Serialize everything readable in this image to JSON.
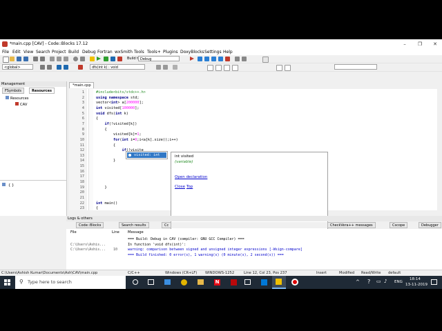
{
  "window": {
    "title": "*main.cpp [CAV] - Code::Blocks 17.12"
  },
  "menu": [
    "File",
    "Edit",
    "View",
    "Search",
    "Project",
    "Build",
    "Debug",
    "Fortran",
    "wxSmith",
    "Tools",
    "Tools+",
    "Plugins",
    "DoxyBlocks",
    "Settings",
    "Help"
  ],
  "toolbar": {
    "build_target": "Debug",
    "scope": "<global>",
    "function": "dfs(int k) : void"
  },
  "management": {
    "title": "Management",
    "tabs": [
      "FSymbols",
      "Resources"
    ],
    "active_tab": "Resources",
    "tree": [
      "Resources",
      "CAV"
    ],
    "bottom_item": "{ }"
  },
  "editor": {
    "tab": "*main.cpp",
    "line_numbers": [
      "1",
      "2",
      "3",
      "4",
      "5",
      "6",
      "7",
      "8",
      "9",
      "10",
      "11",
      "12",
      "13",
      "14",
      "15",
      "16",
      "17",
      "18",
      "19",
      "20",
      "21",
      "22",
      "23"
    ],
    "lines": [
      "#include<bits/stdc++.h>",
      "using namespace std;",
      "vector<int> a[200000];",
      "int visited[100000];",
      "void dfs(int k)",
      "{",
      "    if(!visited[k])",
      "    {",
      "        visited[k]=1;",
      "        for(int i=0;i<a[k].size();i++)",
      "        {",
      "            if(!visite",
      "",
      "        }",
      "",
      "",
      "",
      "",
      "    }",
      "",
      "",
      "int main()",
      "{"
    ],
    "autocomplete": {
      "item": "visited: int"
    },
    "tooltip": {
      "signature": "int visited",
      "kind": "(variable)",
      "open_declaration": "Open declaration",
      "close": "Close",
      "top": "Top"
    }
  },
  "logs": {
    "title": "Logs & others",
    "tabs": [
      "Code::Blocks",
      "Search results",
      "Cc",
      "CheckVera++ messages",
      "Cscope",
      "Debugger"
    ],
    "headers": [
      "File",
      "Line",
      "Message"
    ],
    "rows": [
      {
        "file": "",
        "line": "",
        "message": "=== Build: Debug in CAV (compiler: GNU GCC Compiler) ===",
        "color": "#000000"
      },
      {
        "file": "C:\\Users\\Ashis...",
        "line": "",
        "message": "In function 'void dfs(int)':",
        "color": "#000000"
      },
      {
        "file": "C:\\Users\\Ashis...",
        "line": "10",
        "message": "warning: comparison between signed and unsigned integer expressions [-Wsign-compare]",
        "color": "#0000cc"
      },
      {
        "file": "",
        "line": "",
        "message": "=== Build finished: 0 error(s), 1 warning(s) (0 minute(s), 2 second(s)) ===",
        "color": "#0000cc"
      }
    ]
  },
  "status": {
    "path": "C:\\Users\\Ashish Kumar\\Documents\\Ash\\CAV\\main.cpp",
    "lang": "C/C++",
    "eol": "Windows (CR+LF)",
    "encoding": "WINDOWS-1252",
    "pos": "Line 12, Col 23, Pos 237",
    "mode": "Insert",
    "modified": "Modified",
    "rw": "Read/Write",
    "profile": "default"
  },
  "taskbar": {
    "search": "Type here to search",
    "lang": "ENG",
    "time": "18:14",
    "date": "13-11-2019"
  }
}
